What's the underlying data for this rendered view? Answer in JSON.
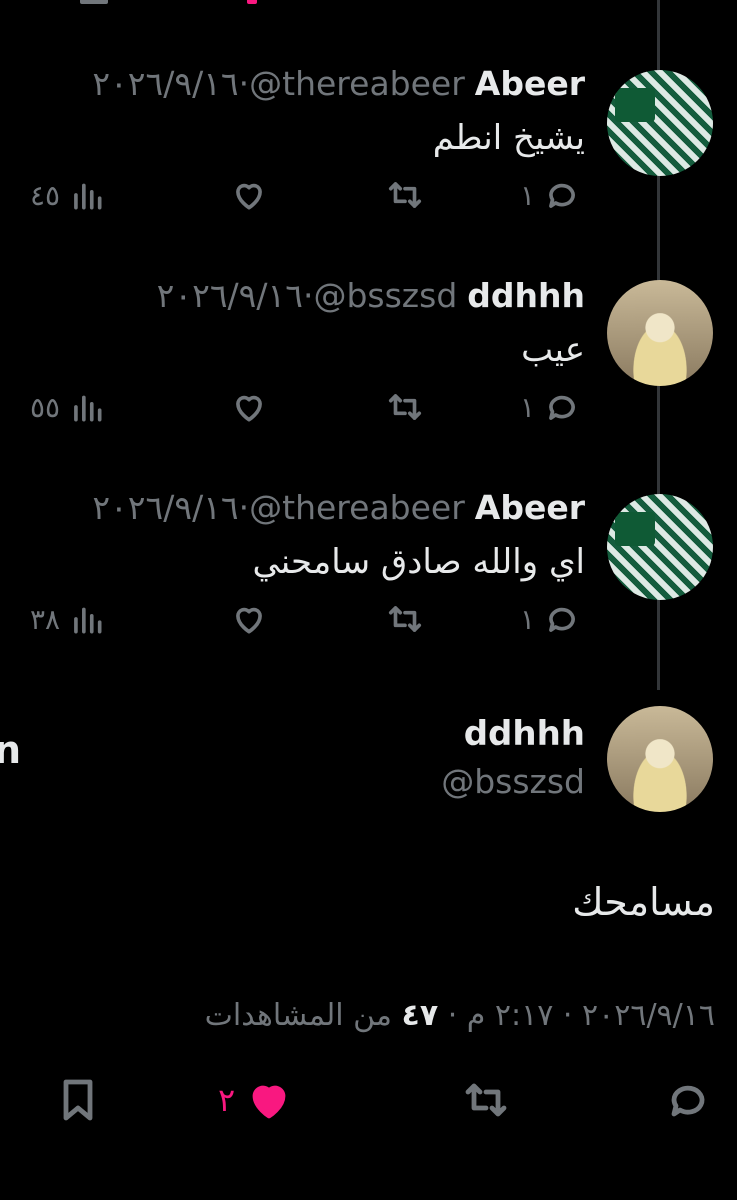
{
  "replies": [
    {
      "name": "Abeer",
      "handle": "@thereabeer",
      "date": "٢٠٢٦/٩/١٦",
      "text": "يشيخ انطم",
      "reply_count": "١",
      "views": "٤٥",
      "avatar_icon": "avatar-green-pattern"
    },
    {
      "name": "ddhhh",
      "handle": "@bsszsd",
      "date": "٢٠٢٦/٩/١٦",
      "text": "عيب",
      "reply_count": "١",
      "views": "٥٥",
      "avatar_icon": "avatar-person"
    },
    {
      "name": "Abeer",
      "handle": "@thereabeer",
      "date": "٢٠٢٦/٩/١٦",
      "text": "اي والله صادق سامحني",
      "reply_count": "١",
      "views": "٣٨",
      "avatar_icon": "avatar-green-pattern"
    }
  ],
  "main_tweet": {
    "name": "ddhhh",
    "handle": "@bsszsd",
    "text": "مسامحك",
    "date": "٢٠٢٦/٩/١٦",
    "time": "٢:١٧ م",
    "views_count": "٤٧",
    "views_label": "من المشاهدات",
    "like_count": "٢"
  },
  "edge_letter": "n",
  "colors": {
    "background": "#000000",
    "text": "#e7e9ea",
    "muted": "#71767b",
    "like": "#f91880"
  }
}
